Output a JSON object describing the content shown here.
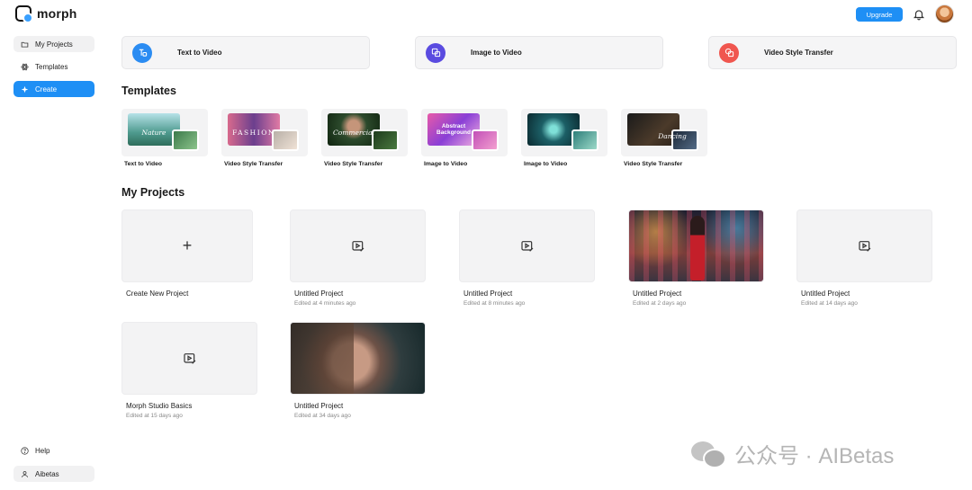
{
  "app": {
    "name": "morph"
  },
  "header": {
    "upgrade_label": "Upgrade"
  },
  "sidebar": {
    "items": [
      {
        "label": "My Projects",
        "icon": "folder-icon"
      },
      {
        "label": "Templates",
        "icon": "atom-icon"
      },
      {
        "label": "Create",
        "icon": "sparkle-icon"
      }
    ],
    "bottom": [
      {
        "label": "Help",
        "icon": "help-icon"
      },
      {
        "label": "Aibetas",
        "icon": "user-icon"
      }
    ]
  },
  "features": [
    {
      "label": "Text to Video",
      "icon": "text-to-video-icon",
      "color": "#2b8cf2"
    },
    {
      "label": "Image to Video",
      "icon": "image-to-video-icon",
      "color": "#5a4be0"
    },
    {
      "label": "Video Style Transfer",
      "icon": "style-transfer-icon",
      "color": "#f0564f"
    }
  ],
  "templates": {
    "heading": "Templates",
    "items": [
      {
        "label": "Text to Video",
        "word": "Nature"
      },
      {
        "label": "Video Style Transfer",
        "word": "FASHION"
      },
      {
        "label": "Video Style Transfer",
        "word": "Commercial"
      },
      {
        "label": "Image to Video",
        "word": "Abstract Background"
      },
      {
        "label": "Image to Video",
        "word": ""
      },
      {
        "label": "Video Style Transfer",
        "word": "Dancing"
      }
    ]
  },
  "projects": {
    "heading": "My Projects",
    "create_label": "Create New Project",
    "items": [
      {
        "title": "Untitled Project",
        "edited": "Edited at 4 minutes ago"
      },
      {
        "title": "Untitled Project",
        "edited": "Edited at 8 minutes ago"
      },
      {
        "title": "Untitled Project",
        "edited": "Edited at 2 days ago"
      },
      {
        "title": "Untitled Project",
        "edited": "Edited at 14 days ago"
      },
      {
        "title": "Morph Studio Basics",
        "edited": "Edited at 15 days ago"
      },
      {
        "title": "Untitled Project",
        "edited": "Edited at 34 days ago"
      }
    ]
  },
  "watermark": {
    "text": "公众号 · AIBetas"
  }
}
